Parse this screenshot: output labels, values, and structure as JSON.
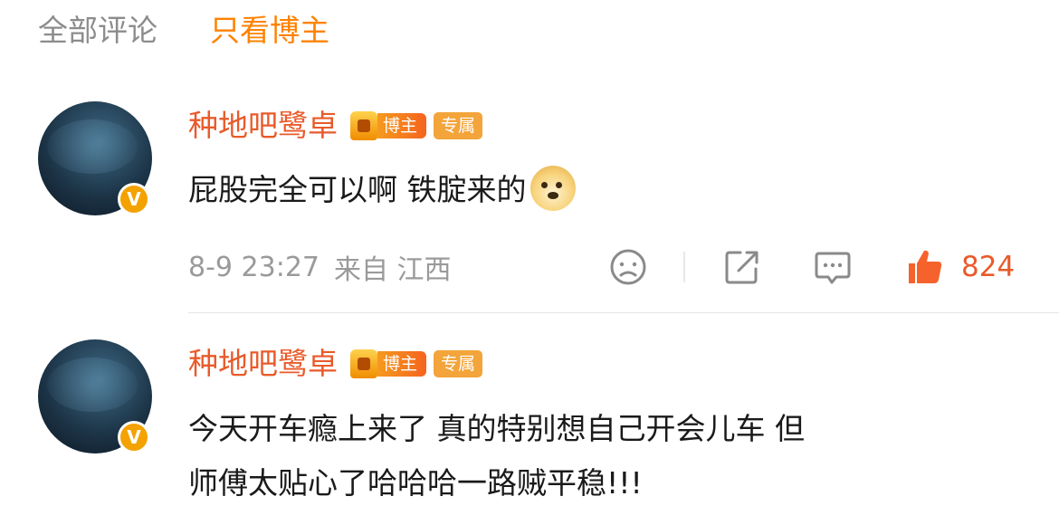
{
  "tabs": [
    {
      "label": "全部评论",
      "active": false
    },
    {
      "label": "只看博主",
      "active": true
    }
  ],
  "comments": [
    {
      "name": "种地吧鹭卓",
      "badge_blogger": "博主",
      "badge_exclusive": "专属",
      "lines": [
        "屁股完全可以啊 铁腚来的"
      ],
      "emoji": "doge-emoji",
      "time": "8-9 23:27",
      "source": "来自 江西",
      "likes": "824"
    },
    {
      "name": "种地吧鹭卓",
      "badge_blogger": "博主",
      "badge_exclusive": "专属",
      "lines": [
        "今天开车瘾上来了 真的特别想自己开会儿车 但",
        "师傅太贴心了哈哈哈一路贼平稳!!!"
      ]
    }
  ],
  "colors": {
    "accent": "#ff8200",
    "name": "#e95a2a",
    "verified": "#f3a200",
    "text": "#1a1a1a",
    "meta": "#9a9a9a"
  },
  "icons": [
    "sad-face-icon",
    "share-icon",
    "comment-icon",
    "like-icon",
    "verified-v-icon",
    "crown-icon"
  ]
}
